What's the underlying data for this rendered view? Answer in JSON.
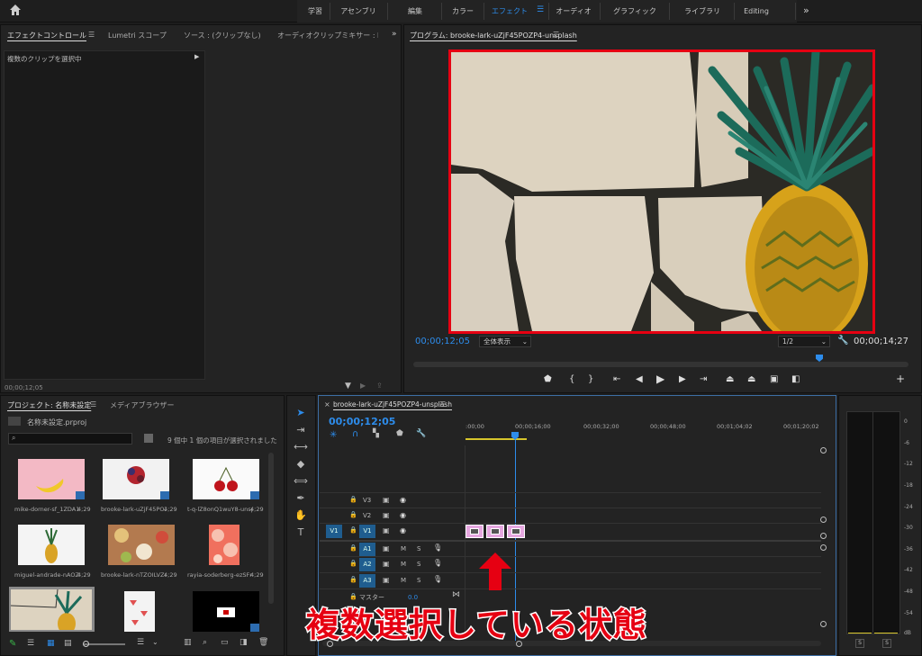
{
  "topbar": {
    "home_icon": "home-icon",
    "workspaces": [
      "学習",
      "アセンブリ",
      "編集",
      "カラー",
      "エフェクト",
      "オーディオ",
      "グラフィック",
      "ライブラリ",
      "Editing"
    ],
    "active_workspace": "エフェクト",
    "more_icon": "chevron-double-right-icon"
  },
  "effect_controls": {
    "tabs": [
      "エフェクトコントロール",
      "Lumetri スコープ",
      "ソース : (クリップなし)",
      "オーディオクリップミキサー : br"
    ],
    "status": "複数のクリップを選択中",
    "timecode": "00;00;12;05"
  },
  "program": {
    "title": "プログラム: brooke-lark-uZjF45POZP4-unsplash",
    "timecode": "00;00;12;05",
    "fit": "全体表示",
    "resolution": "1/2",
    "duration": "00;00;14;27",
    "playhead_fraction": 0.82
  },
  "project": {
    "tabs": [
      "プロジェクト: 名称未設定",
      "メディアブラウザー"
    ],
    "file": "名称未設定.prproj",
    "count_text": "9 個中 1 個の項目が選択されました",
    "items": [
      {
        "name": "mike-dorner-sf_1ZDA1Y...",
        "dur": "4;29"
      },
      {
        "name": "brooke-lark-uZjF45POZ...",
        "dur": "4;29"
      },
      {
        "name": "t-q-lZ8onQ1wuY8-unspl...",
        "dur": "4;29"
      },
      {
        "name": "miguel-andrade-nAOZCY...",
        "dur": "4;29"
      },
      {
        "name": "brooke-lark-nTZOILVZu...",
        "dur": "4;29"
      },
      {
        "name": "rayia-soderberg-ezSFnAF...",
        "dur": "4;29"
      },
      {
        "name": "",
        "dur": ""
      },
      {
        "name": "",
        "dur": ""
      },
      {
        "name": "",
        "dur": ""
      }
    ]
  },
  "sequence": {
    "name": "brooke-lark-uZjF45POZP4-unsplash",
    "timecode": "00;00;12;05",
    "ruler": [
      ":00;00",
      "00;00;16;00",
      "00;00;32;00",
      "00;00;48;00",
      "00;01;04;02",
      "00;01;20;02"
    ],
    "video_tracks": [
      "V3",
      "V2",
      "V1"
    ],
    "audio_tracks": [
      "A1",
      "A2",
      "A3"
    ],
    "source_target": "V1",
    "master_label": "マスター",
    "master_value": "0.0",
    "mute": "M",
    "solo": "S"
  },
  "meter": {
    "scale": [
      "0",
      "-6",
      "-12",
      "-18",
      "-24",
      "-30",
      "-36",
      "-42",
      "-48",
      "-54",
      "dB"
    ],
    "solo": [
      "S",
      "S"
    ]
  },
  "annotation": "複数選択している状態",
  "colors": {
    "accent": "#2d8ceb",
    "highlight": "#e60012",
    "clip": "#e6a7e0"
  }
}
